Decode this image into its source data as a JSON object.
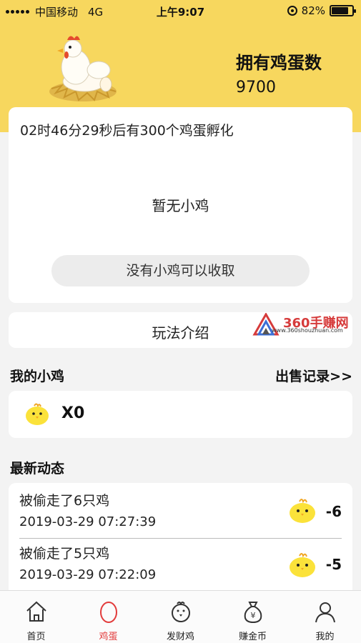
{
  "status_bar": {
    "carrier": "中国移动",
    "network": "4G",
    "time": "上午9:07",
    "battery_percent": "82%",
    "battery_level": 0.82
  },
  "header": {
    "egg_label": "拥有鸡蛋数",
    "egg_count": "9700"
  },
  "main_card": {
    "countdown": "02时46分29秒后有300个鸡蛋孵化",
    "empty_text": "暂无小鸡",
    "collect_button": "没有小鸡可以收取"
  },
  "howto": {
    "label": "玩法介绍"
  },
  "watermark": {
    "brand": "360手赚网",
    "url": "www.360shouzhuan.com"
  },
  "my_chicks": {
    "title": "我的小鸡",
    "sales_link": "出售记录>>",
    "count": "X0"
  },
  "news": {
    "title": "最新动态",
    "items": [
      {
        "desc": "被偷走了6只鸡",
        "time": "2019-03-29 07:27:39",
        "delta": "-6"
      },
      {
        "desc": "被偷走了5只鸡",
        "time": "2019-03-29 07:22:09",
        "delta": "-5"
      }
    ]
  },
  "tabs": [
    {
      "label": "首页",
      "icon": "home-icon"
    },
    {
      "label": "鸡蛋",
      "icon": "egg-icon"
    },
    {
      "label": "发财鸡",
      "icon": "chicken-icon"
    },
    {
      "label": "赚金币",
      "icon": "money-bag-icon"
    },
    {
      "label": "我的",
      "icon": "profile-icon"
    }
  ],
  "colors": {
    "header_yellow": "#f7d75e",
    "chick_yellow": "#fbe23a",
    "active_tab": "#e23b3b"
  }
}
